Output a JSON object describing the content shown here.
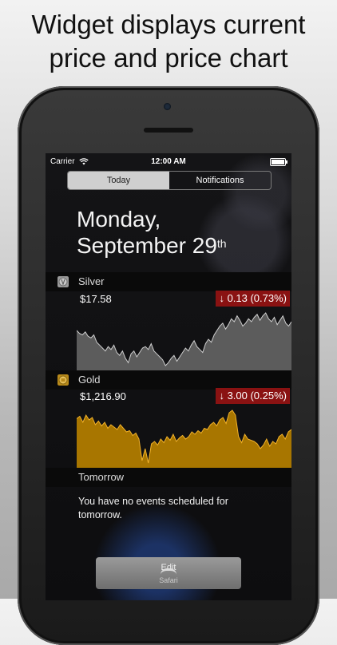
{
  "headline": {
    "line1": "Widget displays current",
    "line2": "price and price chart"
  },
  "status_bar": {
    "carrier": "Carrier",
    "time": "12:00 AM"
  },
  "segments": {
    "today": "Today",
    "notifications": "Notifications"
  },
  "date": {
    "weekday": "Monday,",
    "date": "September 29",
    "suffix": "th"
  },
  "widgets": {
    "silver": {
      "name": "Silver",
      "price": "$17.58",
      "change": "0.13 (0.73%)",
      "arrow": "↓",
      "colors": {
        "fill": "#5c5c5c",
        "line": "#cfcfcf"
      },
      "series": [
        52,
        50,
        49,
        51,
        48,
        47,
        49,
        44,
        42,
        40,
        38,
        41,
        39,
        42,
        37,
        35,
        38,
        33,
        30,
        36,
        38,
        34,
        37,
        40,
        41,
        39,
        43,
        38,
        36,
        34,
        32,
        28,
        30,
        33,
        35,
        31,
        34,
        37,
        40,
        38,
        42,
        45,
        41,
        39,
        37,
        43,
        46,
        44,
        49,
        52,
        55,
        57,
        53,
        56,
        60,
        58,
        62,
        59,
        55,
        57,
        60,
        58,
        61,
        63,
        59,
        62,
        64,
        60,
        58,
        61,
        56,
        59,
        62,
        57,
        55,
        58
      ]
    },
    "gold": {
      "name": "Gold",
      "price": "$1,216.90",
      "change": "3.00 (0.25%)",
      "arrow": "↓",
      "colors": {
        "fill": "#a87600",
        "line": "#f2b22b"
      },
      "series": [
        55,
        57,
        52,
        58,
        54,
        56,
        50,
        53,
        49,
        52,
        47,
        50,
        48,
        46,
        50,
        47,
        44,
        45,
        41,
        43,
        38,
        20,
        30,
        18,
        34,
        36,
        33,
        38,
        35,
        40,
        37,
        42,
        36,
        39,
        41,
        38,
        40,
        44,
        42,
        45,
        43,
        47,
        46,
        50,
        52,
        49,
        54,
        56,
        51,
        60,
        62,
        58,
        40,
        35,
        42,
        38,
        37,
        36,
        34,
        30,
        33,
        38,
        32,
        36,
        34,
        40,
        42,
        38,
        44,
        46
      ]
    }
  },
  "tomorrow": {
    "title": "Tomorrow",
    "message": "You have no events scheduled for tomorrow."
  },
  "edit_button": {
    "label": "Edit"
  },
  "dock": {
    "app_label": "Safari"
  }
}
